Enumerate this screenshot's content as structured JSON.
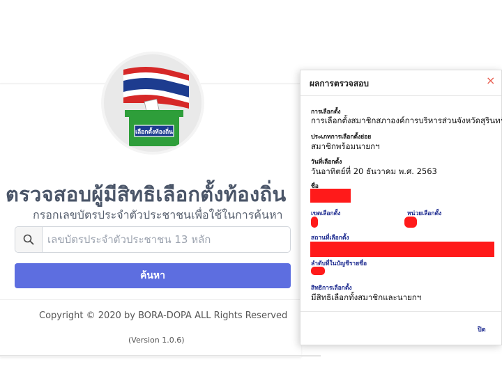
{
  "page": {
    "title": "ตรวจสอบผู้มีสิทธิเลือกตั้งท้องถิ่น",
    "subtitle": "กรอกเลขบัตรประจำตัวประชาชนเพื่อใช้ในการค้นหา",
    "logo": {
      "box_label": "เลือกตั้งท้องถิ่น"
    },
    "search": {
      "placeholder": "เลขบัตรประจำตัวประชาชน 13 หลัก",
      "value": "",
      "button_label": "ค้นหา"
    },
    "footer": {
      "copyright": "Copyright © 2020 by BORA-DOPA ALL Rights Reserved",
      "version": "(Version 1.0.6)"
    }
  },
  "modal": {
    "title": "ผลการตรวจสอบ",
    "close_icon": "×",
    "fields": {
      "election_label": "การเลือกตั้ง",
      "election_value": "การเลือกตั้งสมาชิกสภาองค์การบริหารส่วนจังหวัดสุรินทร์",
      "type_label": "ประเภทการเลือกตั้งย่อย",
      "type_value": "สมาชิกพร้อมนายกฯ",
      "date_label": "วันที่เลือกตั้ง",
      "date_value": "วันอาทิตย์ที่ 20 ธันวาคม พ.ศ. 2563",
      "name_label": "ชื่อ",
      "district_label": "เขตเลือกตั้ง",
      "unit_label": "หน่วยเลือกตั้ง",
      "place_label": "สถานที่เลือกตั้ง",
      "order_label": "ลำดับที่ในบัญชีรายชื่อ",
      "right_label": "สิทธิการเลือกตั้ง",
      "right_value": "มีสิทธิเลือกทั้งสมาชิกและนายกฯ"
    },
    "close_button_label": "ปิด"
  },
  "colors": {
    "accent": "#5d6ee0",
    "title_text": "#4a5568",
    "label_blue": "#1c2a8f",
    "redaction": "#ff1a1a",
    "close_icon": "#e85b4d"
  }
}
